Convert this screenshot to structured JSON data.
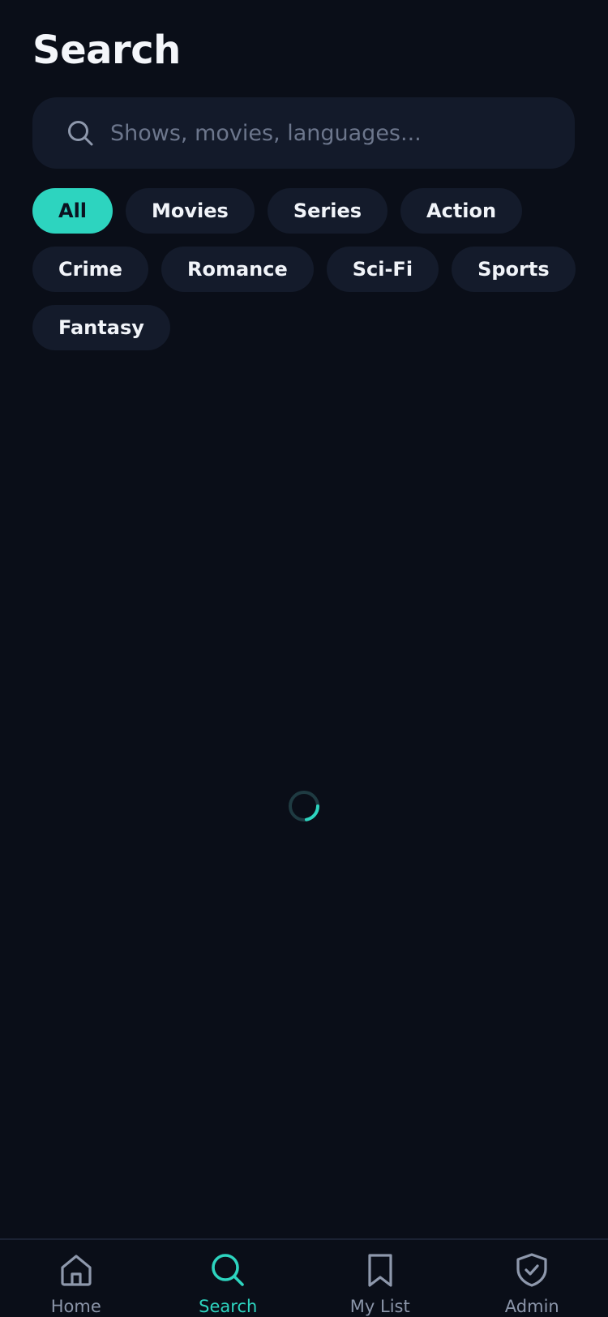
{
  "header": {
    "title": "Search"
  },
  "search": {
    "placeholder": "Shows, movies, languages...",
    "value": "",
    "icon": "search-icon"
  },
  "filters": {
    "selected": "All",
    "items": [
      {
        "label": "All"
      },
      {
        "label": "Movies"
      },
      {
        "label": "Series"
      },
      {
        "label": "Action"
      },
      {
        "label": "Crime"
      },
      {
        "label": "Romance"
      },
      {
        "label": "Sci-Fi"
      },
      {
        "label": "Sports"
      },
      {
        "label": "Fantasy"
      }
    ]
  },
  "status": {
    "loading": true,
    "spinner_icon": "loading-spinner-icon"
  },
  "bottom_nav": {
    "active": "Search",
    "items": [
      {
        "label": "Home",
        "icon": "home-icon"
      },
      {
        "label": "Search",
        "icon": "search-icon"
      },
      {
        "label": "My List",
        "icon": "bookmark-icon"
      },
      {
        "label": "Admin",
        "icon": "shield-check-icon"
      }
    ]
  },
  "colors": {
    "background": "#0a0e18",
    "surface": "#131a2a",
    "chip": "#141b2b",
    "accent": "#2dd4bf",
    "muted_text": "#8a94a8",
    "placeholder": "#6c768c"
  }
}
